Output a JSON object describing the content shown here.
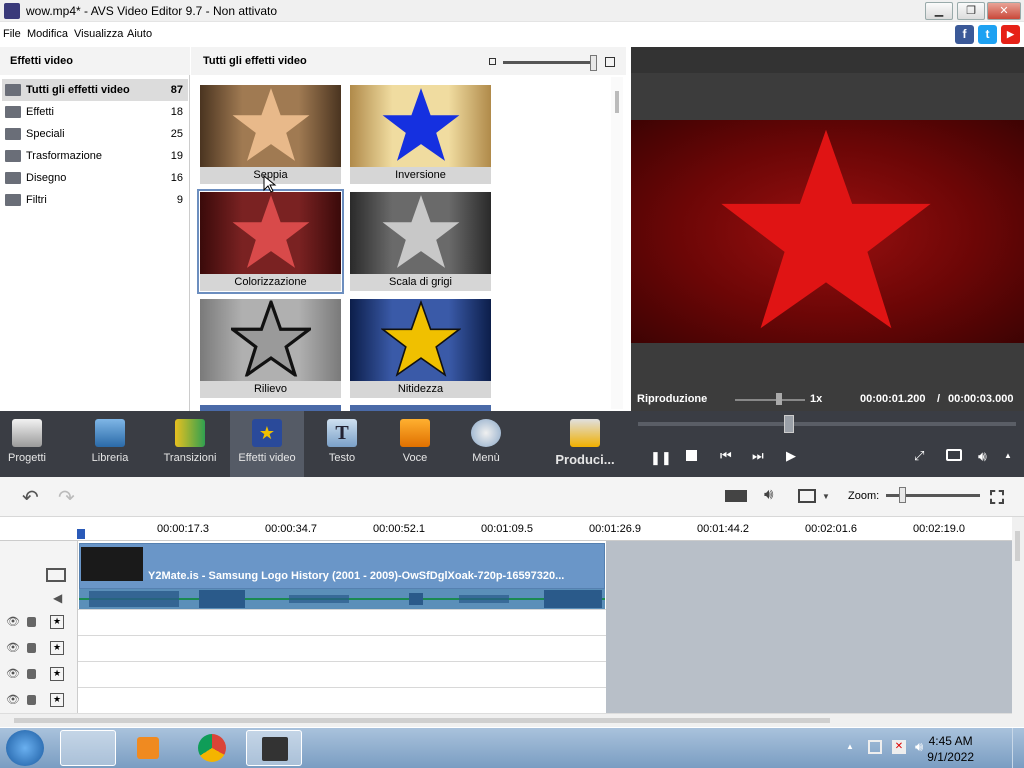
{
  "window": {
    "title": "wow.mp4* - AVS Video Editor 9.7 - Non attivato",
    "min": "▁",
    "max": "❐",
    "close": "✕"
  },
  "menu": {
    "items": [
      "File",
      "Modifica",
      "Visualizza",
      "Aiuto"
    ]
  },
  "social": {
    "facebook": "f",
    "twitter": "t",
    "youtube": "▶"
  },
  "left_panel": {
    "header": "Effetti video",
    "categories": [
      {
        "label": "Tutti gli effetti video",
        "count": "87",
        "selected": true
      },
      {
        "label": "Effetti",
        "count": "18"
      },
      {
        "label": "Speciali",
        "count": "25"
      },
      {
        "label": "Trasformazione",
        "count": "19"
      },
      {
        "label": "Disegno",
        "count": "16"
      },
      {
        "label": "Filtri",
        "count": "9"
      }
    ]
  },
  "grid": {
    "header": "Tutti gli effetti video",
    "tiles": [
      {
        "label": "Seppia",
        "bg": "#7a5a3a",
        "star": "#e8b98a"
      },
      {
        "label": "Inversione",
        "bg": "#e2c27a",
        "star": "#1530e0"
      },
      {
        "label": "Colorizzazione",
        "bg": "#6b1a1a",
        "star": "#d84a4a",
        "selected": true
      },
      {
        "label": "Scala di grigi",
        "bg": "#4a4a4a",
        "star": "#c8c8c8"
      },
      {
        "label": "Rilievo",
        "bg": "#9a9a9a",
        "star": "#d8d8d8"
      },
      {
        "label": "Nitidezza",
        "bg": "#1c3a7a",
        "star": "#f0c000"
      }
    ]
  },
  "preview": {
    "status_label": "Riproduzione",
    "speed": "1x",
    "current_time": "00:00:01.200",
    "separator": "/",
    "total_time": "00:00:03.000",
    "star_color": "#e01414"
  },
  "toolbar": {
    "buttons": [
      {
        "label": "Progetti",
        "icon": "clapperboard-icon"
      },
      {
        "label": "Libreria",
        "icon": "film-library-icon"
      },
      {
        "label": "Transizioni",
        "icon": "transition-icon"
      },
      {
        "label": "Effetti video",
        "icon": "star-effect-icon",
        "active": true
      },
      {
        "label": "Testo",
        "icon": "text-icon"
      },
      {
        "label": "Voce",
        "icon": "microphone-icon"
      },
      {
        "label": "Menù",
        "icon": "disc-menu-icon"
      }
    ],
    "produce_label": "Produci..."
  },
  "timeline": {
    "zoom_label": "Zoom:",
    "ticks": [
      "00:00:17.3",
      "00:00:34.7",
      "00:00:52.1",
      "00:01:09.5",
      "00:01:26.9",
      "00:01:44.2",
      "00:02:01.6",
      "00:02:19.0"
    ],
    "clip_label": "Y2Mate.is - Samsung Logo History (2001 - 2009)-OwSfDglXoak-720p-16597320..."
  },
  "taskbar": {
    "time": "4:45 AM",
    "date": "9/1/2022"
  }
}
